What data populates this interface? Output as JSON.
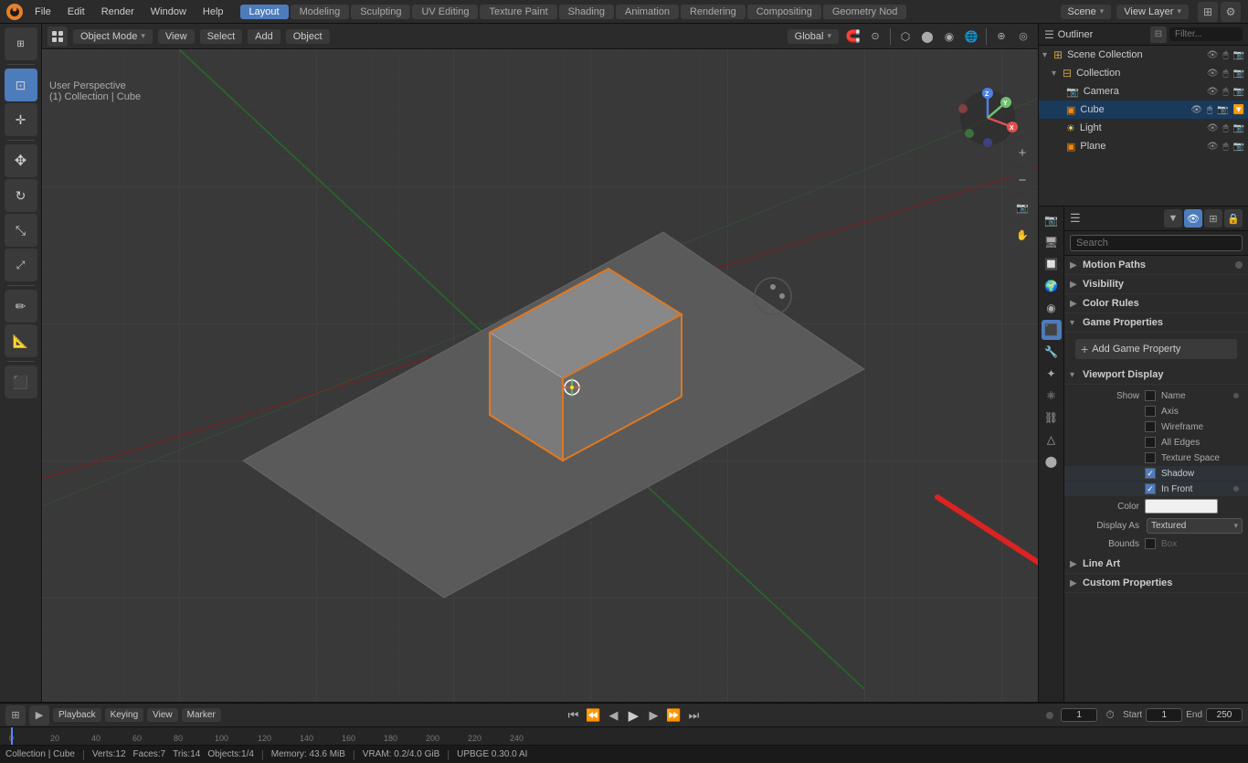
{
  "app": {
    "title": "Blender",
    "file": "File",
    "edit": "Edit",
    "render": "Render",
    "window": "Window",
    "help": "Help"
  },
  "workspaces": [
    {
      "label": "Layout",
      "active": true
    },
    {
      "label": "Modeling",
      "active": false
    },
    {
      "label": "Sculpting",
      "active": false
    },
    {
      "label": "UV Editing",
      "active": false
    },
    {
      "label": "Texture Paint",
      "active": false
    },
    {
      "label": "Shading",
      "active": false
    },
    {
      "label": "Animation",
      "active": false
    },
    {
      "label": "Rendering",
      "active": false
    },
    {
      "label": "Compositing",
      "active": false
    },
    {
      "label": "Geometry Nod",
      "active": false
    }
  ],
  "scene": {
    "name": "Scene",
    "view_layer": "View Layer"
  },
  "viewport": {
    "mode": "Object Mode",
    "view_label": "View",
    "select_label": "Select",
    "add_label": "Add",
    "object_label": "Object",
    "perspective": "User Perspective",
    "collection": "(1) Collection | Cube",
    "transform": "Global"
  },
  "gizmo": {
    "x_color": "#e05050",
    "y_color": "#70c070",
    "z_color": "#5080e0"
  },
  "outliner": {
    "title": "Outliner",
    "items": [
      {
        "label": "Scene Collection",
        "level": 0,
        "icon": "📁",
        "type": "scene_collection"
      },
      {
        "label": "Collection",
        "level": 1,
        "icon": "📁",
        "type": "collection",
        "expanded": true
      },
      {
        "label": "Camera",
        "level": 2,
        "icon": "📷",
        "type": "camera"
      },
      {
        "label": "Cube",
        "level": 2,
        "icon": "⬜",
        "type": "mesh",
        "selected": true,
        "active": true
      },
      {
        "label": "Light",
        "level": 2,
        "icon": "💡",
        "type": "light"
      },
      {
        "label": "Plane",
        "level": 2,
        "icon": "⬜",
        "type": "mesh"
      }
    ]
  },
  "properties": {
    "search_placeholder": "Search",
    "sections": {
      "motion_paths": {
        "label": "Motion Paths",
        "expanded": false
      },
      "visibility": {
        "label": "Visibility",
        "expanded": false
      },
      "color_rules": {
        "label": "Color Rules",
        "expanded": false
      },
      "game_properties": {
        "label": "Game Properties",
        "expanded": true,
        "add_btn": "Add Game Property"
      },
      "viewport_display": {
        "label": "Viewport Display",
        "expanded": true,
        "show_label": "Show",
        "checkboxes": [
          {
            "label": "Name",
            "checked": false
          },
          {
            "label": "Axis",
            "checked": false
          },
          {
            "label": "Wireframe",
            "checked": false
          },
          {
            "label": "All Edges",
            "checked": false
          },
          {
            "label": "Texture Space",
            "checked": false
          },
          {
            "label": "Shadow",
            "checked": true
          },
          {
            "label": "In Front",
            "checked": true
          }
        ],
        "color_label": "Color",
        "display_as_label": "Display As",
        "display_as_value": "Textured",
        "bounds_label": "Bounds",
        "bounds_value": "Box"
      },
      "line_art": {
        "label": "Line Art",
        "expanded": false
      },
      "custom_properties": {
        "label": "Custom Properties",
        "expanded": false
      }
    }
  },
  "timeline": {
    "playback": "Playback",
    "keying": "Keying",
    "view": "View",
    "marker": "Marker",
    "frame_current": "1",
    "start_label": "Start",
    "start_value": "1",
    "end_label": "End",
    "end_value": "250"
  },
  "status_bar": {
    "collection": "Collection | Cube",
    "verts": "Verts:12",
    "faces": "Faces:7",
    "tris": "Tris:14",
    "objects": "Objects:1/4",
    "memory": "Memory: 43.6 MiB",
    "vram": "VRAM: 0.2/4.0 GiB",
    "upbge": "UPBGE 0.30.0 AI"
  },
  "ruler": {
    "marks": [
      "0",
      "20",
      "40",
      "60",
      "80",
      "100",
      "120",
      "140",
      "160",
      "180",
      "200",
      "220",
      "240"
    ]
  }
}
